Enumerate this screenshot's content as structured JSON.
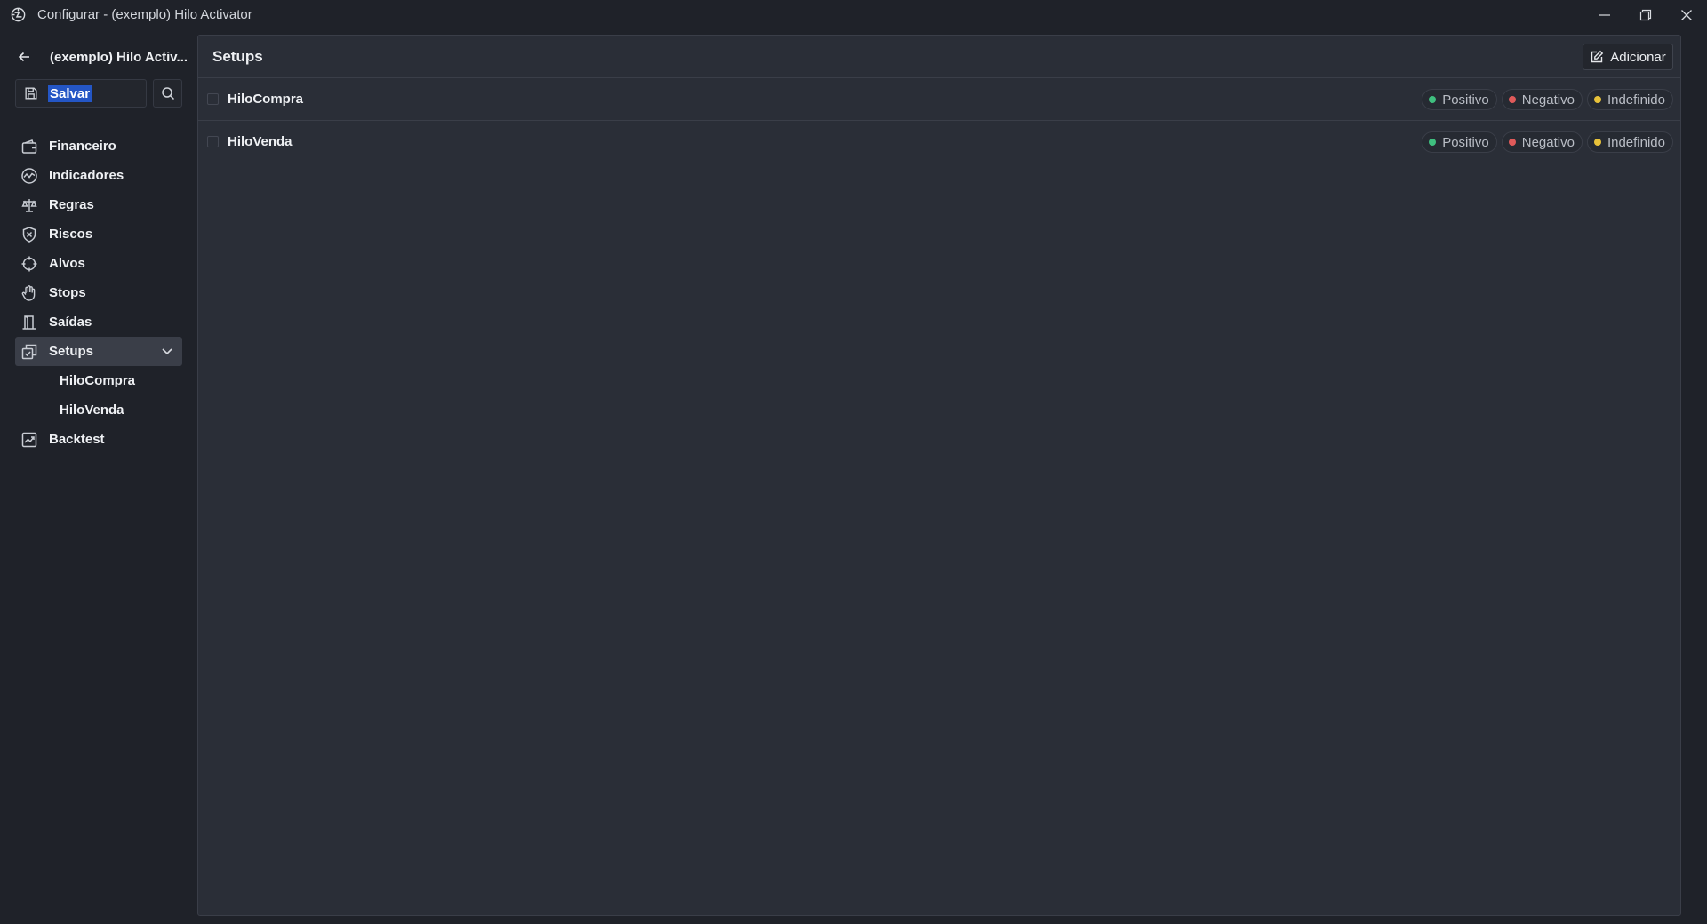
{
  "window": {
    "title": "Configurar - (exemplo) Hilo Activator",
    "controls": [
      "minimize",
      "restore",
      "close"
    ]
  },
  "sidebar": {
    "title": "(exemplo) Hilo Activ...",
    "save_label": "Salvar",
    "items": [
      {
        "label": "Financeiro",
        "icon": "wallet-icon"
      },
      {
        "label": "Indicadores",
        "icon": "chart-circle-icon"
      },
      {
        "label": "Regras",
        "icon": "scale-icon"
      },
      {
        "label": "Riscos",
        "icon": "shield-x-icon"
      },
      {
        "label": "Alvos",
        "icon": "crosshair-icon"
      },
      {
        "label": "Stops",
        "icon": "hand-icon"
      },
      {
        "label": "Saídas",
        "icon": "exit-icon"
      },
      {
        "label": "Setups",
        "icon": "setups-icon",
        "expanded": true
      },
      {
        "label": "HiloCompra"
      },
      {
        "label": "HiloVenda"
      },
      {
        "label": "Backtest",
        "icon": "backtest-icon"
      }
    ]
  },
  "main": {
    "title": "Setups",
    "add_label": "Adicionar",
    "rows": [
      {
        "name": "HiloCompra",
        "badges": [
          "Positivo",
          "Negativo",
          "Indefinido"
        ]
      },
      {
        "name": "HiloVenda",
        "badges": [
          "Positivo",
          "Negativo",
          "Indefinido"
        ]
      }
    ]
  },
  "colors": {
    "positive": "#3fbf7f",
    "negative": "#e05a5a",
    "undefined": "#e8c23a",
    "selection": "#2456c5"
  }
}
